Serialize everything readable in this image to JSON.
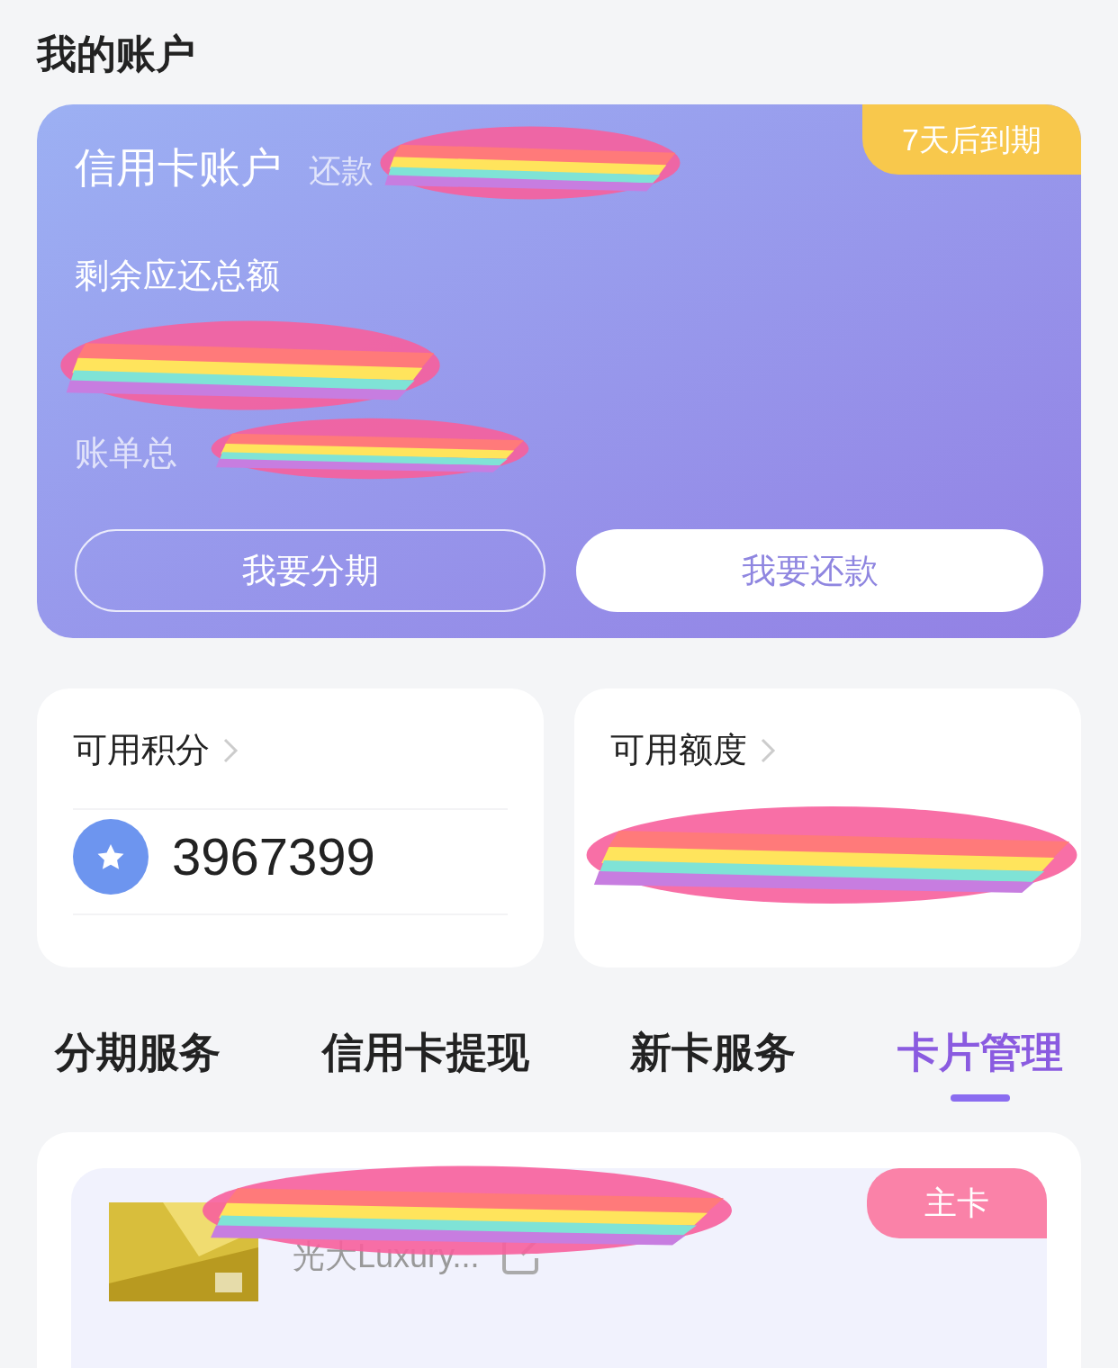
{
  "title": "我的账户",
  "account_card": {
    "title": "信用卡账户",
    "due_label": "还款",
    "due_badge": "7天后到期",
    "remaining_label": "剩余应还总额",
    "bill_label": "账单总",
    "buttons": [
      {
        "label": "我要分期",
        "kind": "outline"
      },
      {
        "label": "我要还款",
        "kind": "solid"
      }
    ]
  },
  "points": {
    "title": "可用积分",
    "value": "3967399"
  },
  "credit": {
    "title": "可用额度"
  },
  "tabs": [
    {
      "label": "分期服务",
      "selected": false
    },
    {
      "label": "信用卡提现",
      "selected": false
    },
    {
      "label": "新卡服务",
      "selected": false
    },
    {
      "label": "卡片管理",
      "selected": true
    }
  ],
  "card": {
    "badge": "主卡",
    "name": "光大Luxury..."
  }
}
